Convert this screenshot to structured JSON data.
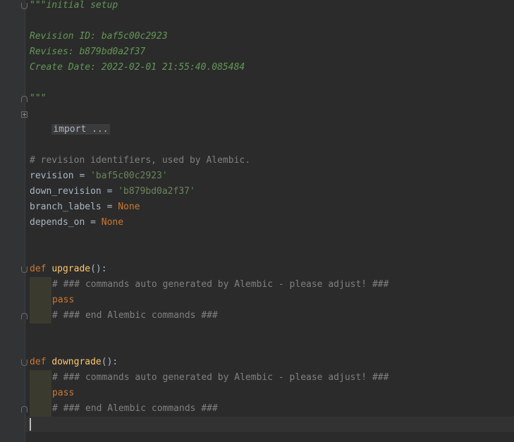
{
  "docstring": {
    "open": "\"\"\"initial setup",
    "revision_id": "Revision ID: baf5c00c2923",
    "revises": "Revises: b879bd0a2f37",
    "create_date": "Create Date: 2022-02-01 21:55:40.085484",
    "close": "\"\"\""
  },
  "imports": {
    "folded": "import ..."
  },
  "identifiers": {
    "comment": "# revision identifiers, used by Alembic.",
    "revision_name": "revision",
    "revision_value": "'baf5c00c2923'",
    "down_revision_name": "down_revision",
    "down_revision_value": "'b879bd0a2f37'",
    "branch_labels_name": "branch_labels",
    "depends_on_name": "depends_on",
    "equals": " = ",
    "none": "None"
  },
  "upgrade": {
    "def": "def",
    "name": "upgrade",
    "parens": "():",
    "comment_start": "# ### commands auto generated by Alembic - please adjust! ###",
    "pass": "pass",
    "comment_end": "# ### end Alembic commands ###"
  },
  "downgrade": {
    "def": "def",
    "name": "downgrade",
    "parens": "():",
    "comment_start": "# ### commands auto generated by Alembic - please adjust! ###",
    "pass": "pass",
    "comment_end": "# ### end Alembic commands ###"
  }
}
